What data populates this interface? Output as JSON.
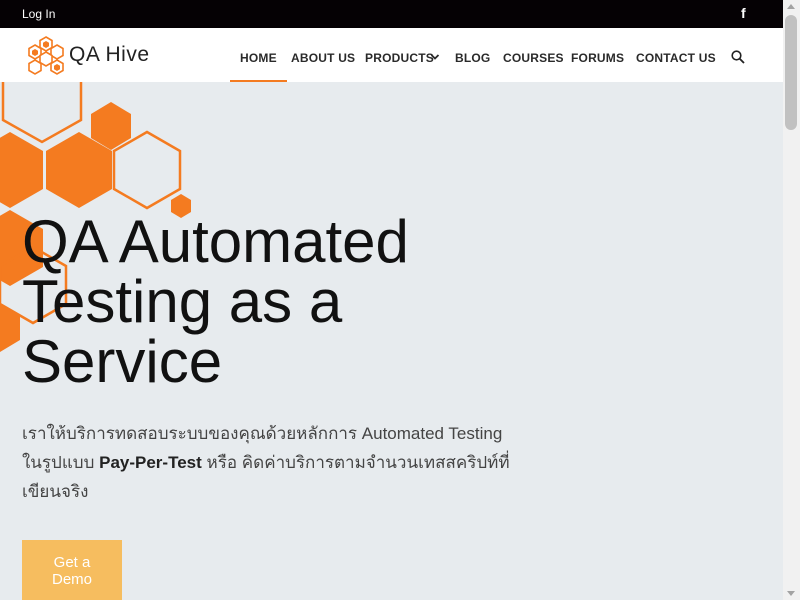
{
  "colors": {
    "accent": "#f47b20",
    "topbar": "#050104",
    "button": "#f6bd5f",
    "hero_bg": "#e7ebee"
  },
  "topbar": {
    "login": "Log In",
    "facebook_icon": "f"
  },
  "brand": {
    "name": "QA Hive",
    "logo_icon": "honeycomb-logo"
  },
  "nav": {
    "items": [
      {
        "label": "HOME",
        "active": true
      },
      {
        "label": "ABOUT US"
      },
      {
        "label": "PRODUCTS",
        "has_dropdown": true
      },
      {
        "label": "BLOG"
      },
      {
        "label": "COURSES"
      },
      {
        "label": "FORUMS"
      },
      {
        "label": "CONTACT US"
      }
    ],
    "search_icon": "search-icon"
  },
  "hero": {
    "title_line1": "QA Automated",
    "title_line2": "Testing as a",
    "title_line3": "Service",
    "desc_part1": "เราให้บริการทดสอบระบบของคุณด้วยหลักการ Automated Testing ในรูปแบบ ",
    "desc_bold": "Pay-Per-Test",
    "desc_part2": " หรือ คิดค่าบริการตามจำนวนเทสสคริปท์ที่เขียนจริง",
    "button": "Get a Demo"
  }
}
